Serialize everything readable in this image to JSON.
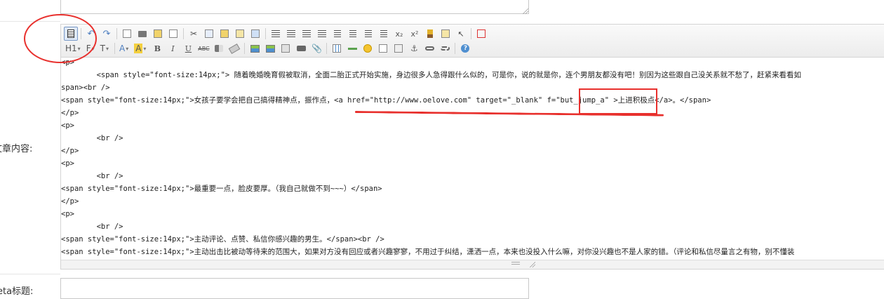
{
  "form": {
    "content_label": "文章内容:",
    "meta_title_label": "eta标题:"
  },
  "toolbar": {
    "heading_label": "H1",
    "font_family_label": "F",
    "font_size_label": "T",
    "font_color_label": "A",
    "highlight_label": "A",
    "bold_label": "B",
    "italic_label": "I",
    "underline_label": "U",
    "strike_label": "ABC",
    "sub_label": "x₂",
    "sup_label": "x²",
    "accent_color": "#e8302d"
  },
  "source_lines": [
    "<p>",
    "        <span style=\"font-size:14px;\"> 随着晚婚晚育假被取消，全面二胎正式开始实施，身边很多人急得跟什么似的，可是你，说的就是你，连个男朋友都没有吧！别因为这些跟自己没关系就不愁了，赶紧来看看如",
    "span><br />",
    "<span style=\"font-size:14px;\">女孩子要学会把自己搞得精神点，振作点，<a href=\"http://www.oelove.com\" target=\"_blank\" f=\"but_jump_a\" >上进积极点</a>。</span>",
    "</p>",
    "<p>",
    "        <br />",
    "</p>",
    "<p>",
    "        <br />",
    "<span style=\"font-size:14px;\">最重要一点，脸皮要厚。（我自己就做不到~~~）</span>",
    "</p>",
    "<p>",
    "        <br />",
    "<span style=\"font-size:14px;\">主动评论、点赞、私信你感兴趣的男生。</span><br />",
    "<span style=\"font-size:14px;\">主动出击比被动等待来的范围大，如果对方没有回应或者兴趣寥寥，不用过于纠结，潇洒一点，本来也没投入什么嘛，对你没兴趣也不是人家的错。（评论和私信尽量言之有物，别不懂装"
  ]
}
